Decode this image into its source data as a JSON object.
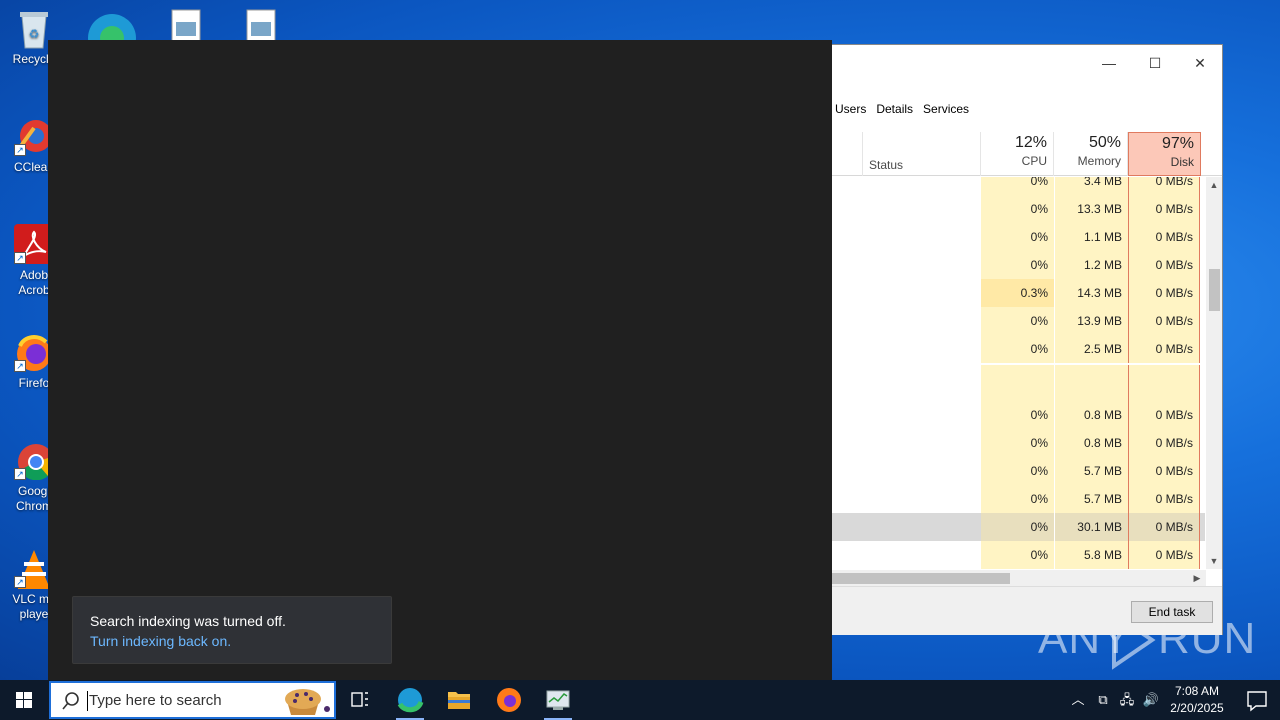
{
  "desktop": {
    "icons": [
      {
        "label": "Recycle",
        "icon": "recycle-bin-icon"
      },
      {
        "label": "CClean",
        "icon": "ccleaner-icon"
      },
      {
        "label": "Adob Acrob",
        "icon": "acrobat-icon"
      },
      {
        "label": "Firefo",
        "icon": "firefox-icon"
      },
      {
        "label": "Googl Chrom",
        "icon": "chrome-icon"
      },
      {
        "label": "VLC me playe",
        "icon": "vlc-icon"
      }
    ]
  },
  "task_manager": {
    "tabs": [
      "Users",
      "Details",
      "Services"
    ],
    "columns": {
      "status": "Status",
      "cpu": {
        "pct": "12%",
        "name": "CPU"
      },
      "memory": {
        "pct": "50%",
        "name": "Memory"
      },
      "disk": {
        "pct": "97%",
        "name": "Disk"
      }
    },
    "rows": [
      {
        "cpu": "0%",
        "mem": "3.4 MB",
        "disk": "0 MB/s"
      },
      {
        "cpu": "0%",
        "mem": "13.3 MB",
        "disk": "0 MB/s"
      },
      {
        "cpu": "0%",
        "mem": "1.1 MB",
        "disk": "0 MB/s"
      },
      {
        "cpu": "0%",
        "mem": "1.2 MB",
        "disk": "0 MB/s"
      },
      {
        "cpu": "0.3%",
        "mem": "14.3 MB",
        "disk": "0 MB/s"
      },
      {
        "cpu": "0%",
        "mem": "13.9 MB",
        "disk": "0 MB/s"
      },
      {
        "cpu": "0%",
        "mem": "2.5 MB",
        "disk": "0 MB/s"
      },
      {
        "cpu": "",
        "mem": "",
        "disk": ""
      },
      {
        "cpu": "0%",
        "mem": "0.8 MB",
        "disk": "0 MB/s"
      },
      {
        "cpu": "0%",
        "mem": "0.8 MB",
        "disk": "0 MB/s"
      },
      {
        "cpu": "0%",
        "mem": "5.7 MB",
        "disk": "0 MB/s"
      },
      {
        "cpu": "0%",
        "mem": "5.7 MB",
        "disk": "0 MB/s"
      },
      {
        "cpu": "0%",
        "mem": "30.1 MB",
        "disk": "0 MB/s"
      },
      {
        "cpu": "0%",
        "mem": "5.8 MB",
        "disk": "0 MB/s"
      }
    ],
    "end_task": "End task"
  },
  "toast": {
    "message": "Search indexing was turned off.",
    "link": "Turn indexing back on."
  },
  "watermark": {
    "left": "ANY",
    "right": "RUN"
  },
  "taskbar": {
    "search_placeholder": "Type here to search",
    "time": "7:08 AM",
    "date": "2/20/2025"
  }
}
